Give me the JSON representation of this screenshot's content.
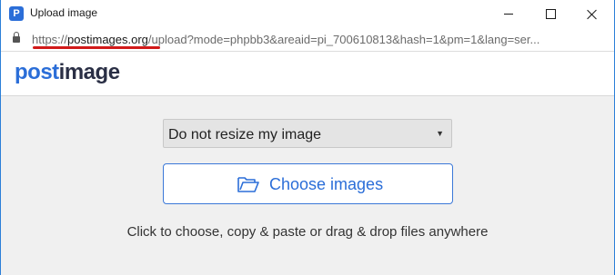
{
  "window": {
    "title": "Upload image",
    "app_icon_letter": "P"
  },
  "address_bar": {
    "url_scheme": "https://",
    "url_host": "postimages.org",
    "url_rest": "/upload?mode=phpbb3&areaid=pi_700610813&hash=1&pm=1&lang=ser..."
  },
  "brand": {
    "logo_part1": "post",
    "logo_part2": "image"
  },
  "main": {
    "resize_select": {
      "selected": "Do not resize my image"
    },
    "choose_button_label": "Choose images",
    "hint": "Click to choose, copy & paste or drag & drop files anywhere"
  },
  "colors": {
    "accent": "#2b6ed8",
    "highlight_underline": "#d11a1a"
  }
}
